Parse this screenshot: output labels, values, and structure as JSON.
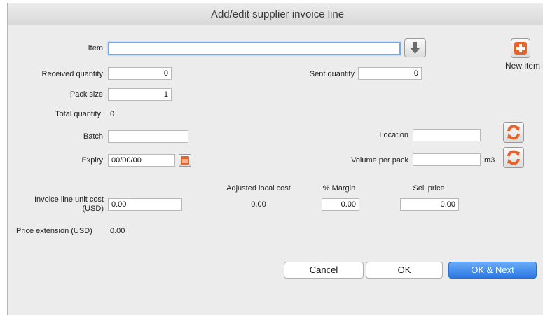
{
  "window": {
    "title": "Add/edit supplier invoice line"
  },
  "item": {
    "label": "Item",
    "value": ""
  },
  "new_item": {
    "label": "New item"
  },
  "received_quantity": {
    "label": "Received quantity",
    "value": "0"
  },
  "sent_quantity": {
    "label": "Sent quantity",
    "value": "0"
  },
  "pack_size": {
    "label": "Pack size",
    "value": "1"
  },
  "total_quantity": {
    "label": "Total quantity:",
    "value": "0"
  },
  "batch": {
    "label": "Batch",
    "value": ""
  },
  "location": {
    "label": "Location",
    "value": ""
  },
  "expiry": {
    "label": "Expiry",
    "value": "00/00/00"
  },
  "volume_per_pack": {
    "label": "Volume per pack",
    "value": "",
    "unit": "m3"
  },
  "cost": {
    "unit_cost_label_line1": "Invoice line unit cost",
    "unit_cost_label_line2": "(USD)",
    "unit_cost_value": "0.00",
    "adjusted_label": "Adjusted local cost",
    "adjusted_value": "0.00",
    "margin_label": "% Margin",
    "margin_value": "0.00",
    "sell_label": "Sell price",
    "sell_value": "0.00"
  },
  "price_extension": {
    "label": "Price extension (USD)",
    "value": "0.00"
  },
  "buttons": {
    "cancel": "Cancel",
    "ok": "OK",
    "ok_next": "OK & Next"
  },
  "colors": {
    "accent": "#2b78e4",
    "icon_orange": "#e8632c"
  }
}
